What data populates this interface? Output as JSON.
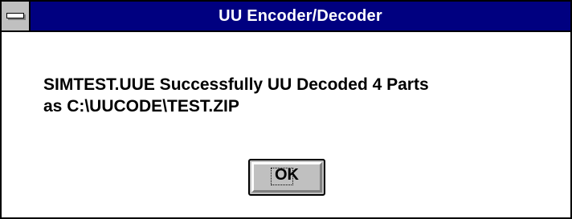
{
  "window": {
    "title": "UU Encoder/Decoder",
    "system_menu_icon": "system-menu-icon"
  },
  "message": {
    "line1": "SIMTEST.UUE Successfully UU Decoded 4 Parts",
    "line2": "as C:\\UUCODE\\TEST.ZIP"
  },
  "buttons": {
    "ok_label": "OK"
  },
  "colors": {
    "titlebar": "#000080",
    "button_face": "#c0c0c0",
    "background": "#ffffff"
  }
}
